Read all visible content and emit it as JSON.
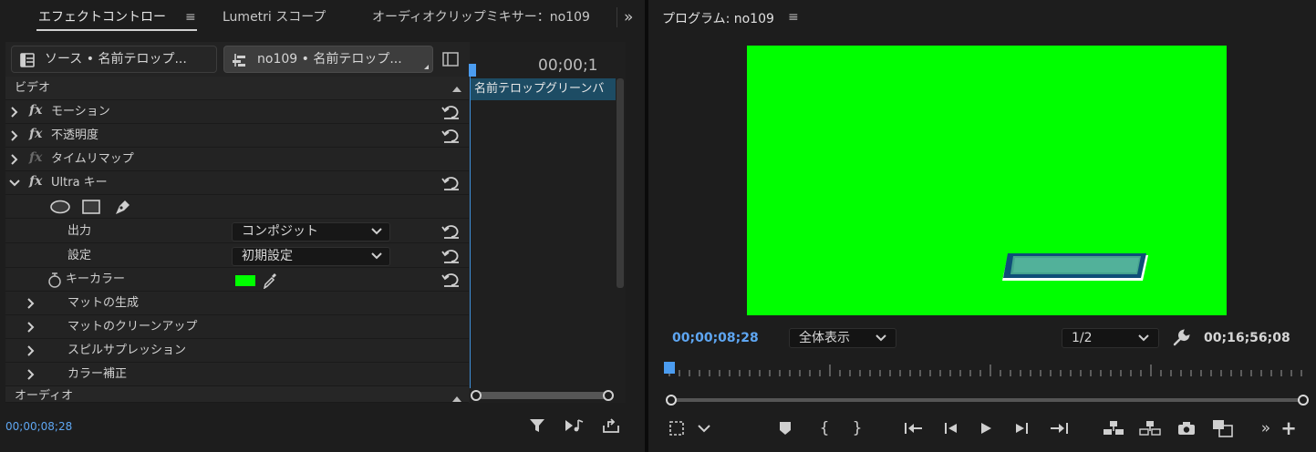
{
  "left_tabs": {
    "effect_controls": "エフェクトコントロー",
    "lumetri": "Lumetri スコープ",
    "audio_mixer": "オーディオクリップミキサー：no109",
    "overflow": "»"
  },
  "clip_selector": {
    "source": "ソース • 名前テロップ...",
    "sequence": "no109 • 名前テロップ..."
  },
  "timeline_mini": {
    "timecode": "00;00;1",
    "clip_label": "名前テロップグリーンバ"
  },
  "effects": {
    "video_header": "ビデオ",
    "motion": "モーション",
    "opacity": "不透明度",
    "time_remap": "タイムリマップ",
    "ultra_key": "Ultra キー",
    "output_label": "出力",
    "output_value": "コンポジット",
    "setting_label": "設定",
    "setting_value": "初期設定",
    "key_color_label": "キーカラー",
    "key_color": "#00ff00",
    "matte_generation": "マットの生成",
    "matte_cleanup": "マットのクリーンアップ",
    "spill_suppression": "スピルサプレッション",
    "color_correction": "カラー補正",
    "audio_header": "オーディオ"
  },
  "left_footer": {
    "timecode": "00;00;08;28"
  },
  "program": {
    "title": "プログラム: no109",
    "current_time": "00;00;08;28",
    "zoom": "全体表示",
    "resolution": "1/2",
    "duration": "00;16;56;08",
    "background_color": "#00ff00",
    "playhead_fraction": 0.0
  },
  "icons": {
    "menu": "hamburger-icon",
    "filter": "funnel-icon",
    "wrench": "wrench-icon"
  }
}
